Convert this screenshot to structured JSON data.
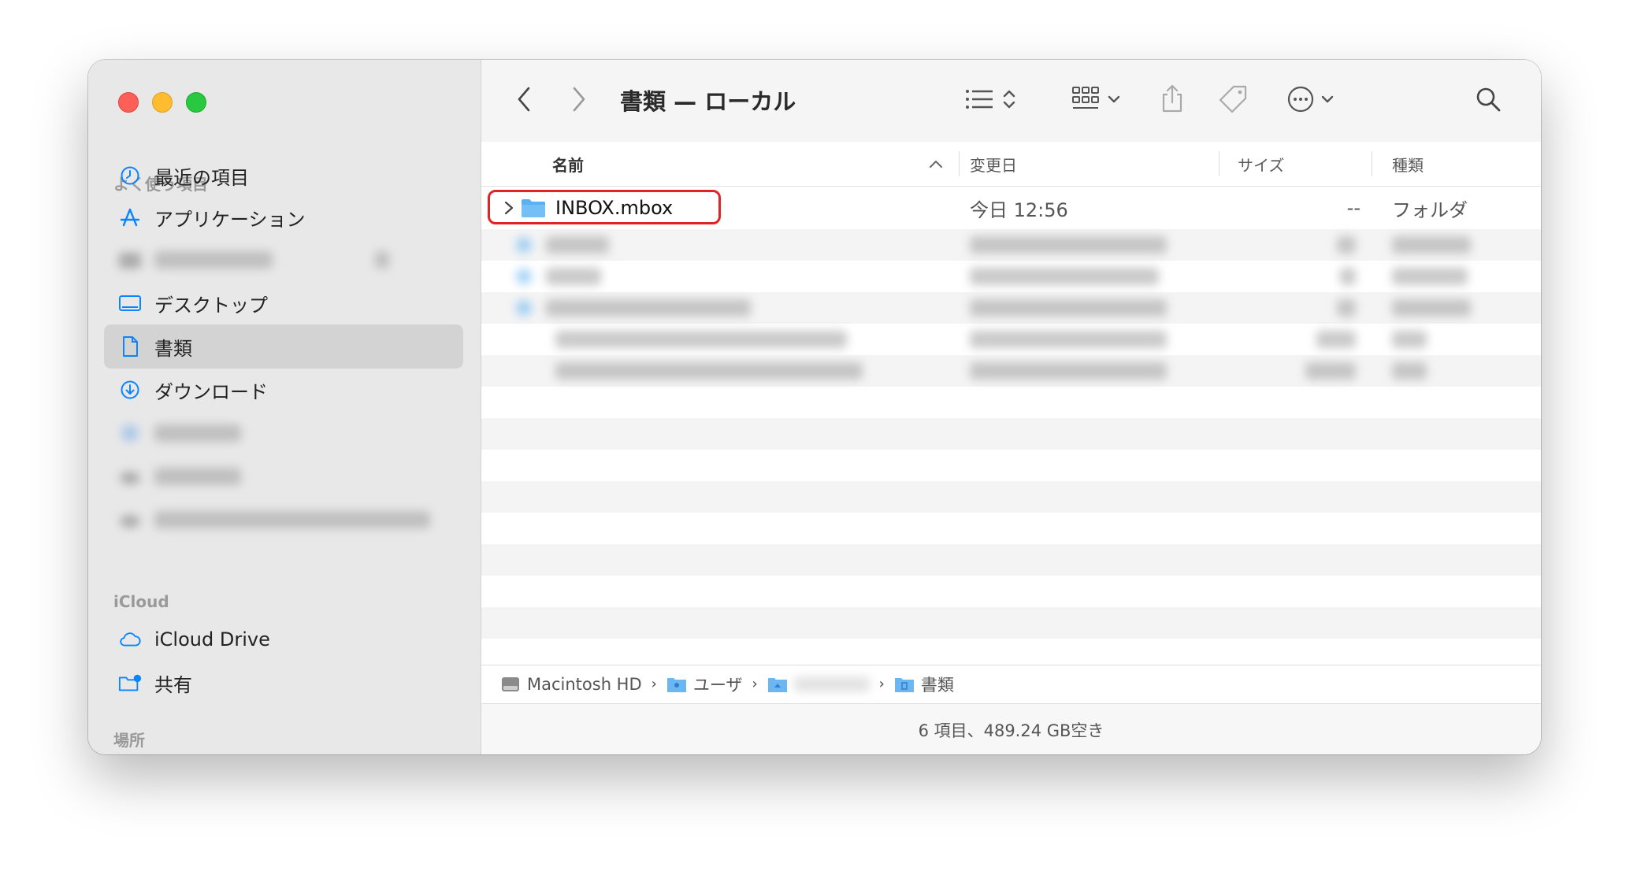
{
  "window": {
    "title": "書類 — ローカル"
  },
  "sidebar": {
    "favorites_header": "よく使う項目",
    "favorites": [
      {
        "label": "最近の項目",
        "icon": "clock-icon"
      },
      {
        "label": "アプリケーション",
        "icon": "apps-icon"
      },
      {
        "label": "デスクトップ",
        "icon": "desktop-icon"
      },
      {
        "label": "書類",
        "icon": "document-icon",
        "selected": true
      },
      {
        "label": "ダウンロード",
        "icon": "download-icon"
      }
    ],
    "icloud_header": "iCloud",
    "icloud": [
      {
        "label": "iCloud Drive",
        "icon": "cloud-icon"
      },
      {
        "label": "共有",
        "icon": "shared-folder-icon"
      }
    ],
    "locations_header": "場所"
  },
  "columns": {
    "name": "名前",
    "modified": "変更日",
    "size": "サイズ",
    "kind": "種類"
  },
  "files": [
    {
      "name": "INBOX.mbox",
      "modified": "今日 12:56",
      "size": "--",
      "kind": "フォルダ",
      "type": "folder",
      "highlighted": true
    }
  ],
  "pathbar": {
    "items": [
      "Macintosh HD",
      "ユーザ",
      "",
      "書類"
    ]
  },
  "status": "6 項目、489.24 GB空き",
  "colors": {
    "accent": "#0a84ff",
    "highlight": "#e02424",
    "folder": "#5ab0f0"
  }
}
